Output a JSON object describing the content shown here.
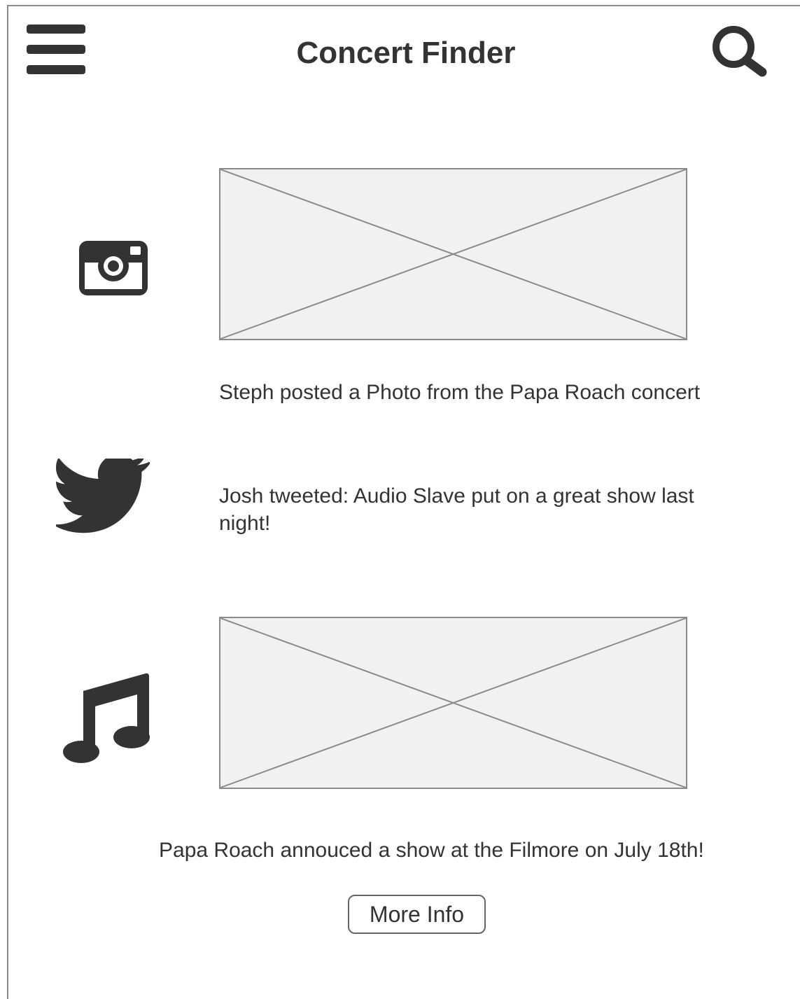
{
  "header": {
    "title": "Concert Finder",
    "menu_icon": "hamburger-menu-icon",
    "search_icon": "search-icon"
  },
  "feed": [
    {
      "platform_icon": "instagram-icon",
      "has_image": true,
      "text": "Steph posted a Photo from the Papa Roach concert"
    },
    {
      "platform_icon": "twitter-icon",
      "has_image": false,
      "text": "Josh tweeted: Audio Slave put on a great show last night!"
    },
    {
      "platform_icon": "music-note-icon",
      "has_image": true,
      "text": "Papa Roach annouced a show at the Filmore on July 18th!"
    }
  ],
  "more_info_button": {
    "label": "More Info"
  },
  "colors": {
    "icon": "#333333",
    "text": "#333333",
    "placeholder_fill": "#f1f1f1",
    "placeholder_border": "#8a8a8a"
  }
}
